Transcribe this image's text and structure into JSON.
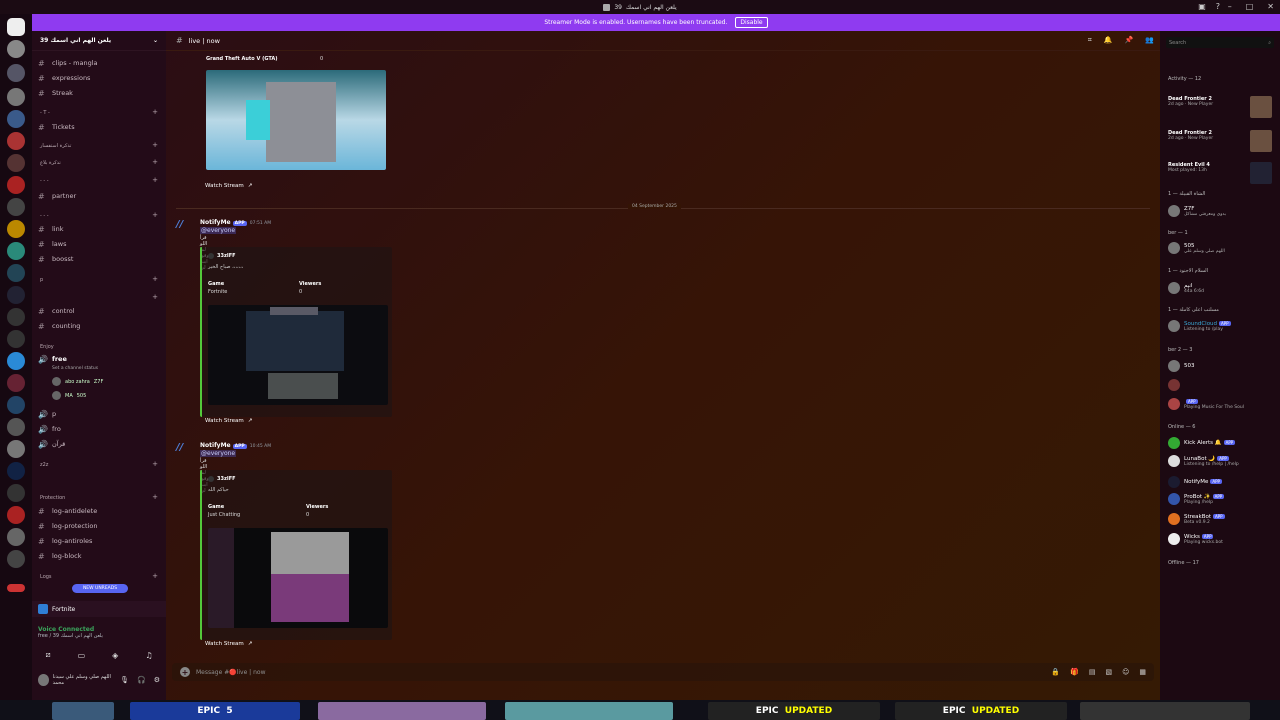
{
  "titlebar": {
    "title": "يلعن الهم اني اسمك",
    "count": "39"
  },
  "streamer": {
    "text": "Streamer Mode is enabled. Usernames have been truncated.",
    "disable_label": "Disable"
  },
  "server": {
    "name": "يلعن الهم اني اسمك",
    "count": "39"
  },
  "channels": [
    {
      "label": "clips - mangla",
      "type": "text"
    },
    {
      "label": "expressions",
      "type": "text"
    },
    {
      "label": "Streak",
      "type": "text"
    },
    {
      "label": "Tickets",
      "type": "text"
    },
    {
      "label": "partner",
      "type": "text"
    },
    {
      "label": "link",
      "type": "text"
    },
    {
      "label": "laws",
      "type": "text"
    },
    {
      "label": "boosst",
      "type": "text"
    },
    {
      "label": "control",
      "type": "text"
    },
    {
      "label": "counting",
      "type": "text"
    },
    {
      "label": "free",
      "type": "voice"
    },
    {
      "label": "p",
      "type": "voice"
    },
    {
      "label": "fro",
      "type": "voice"
    },
    {
      "label": "قرآن",
      "type": "voice"
    },
    {
      "label": "log-antidelete",
      "type": "text"
    },
    {
      "label": "log-protection",
      "type": "text"
    },
    {
      "label": "log-antiroles",
      "type": "text"
    },
    {
      "label": "log-block",
      "type": "text"
    }
  ],
  "categories": [
    "- T -",
    "تذكرة استفسار",
    "تذكرة بلاغ",
    "- - -",
    "- - -",
    "p",
    "Enjoy",
    "z2z",
    "Protection",
    "Logs"
  ],
  "voice": {
    "channel_status": "Set a channel status",
    "users": [
      {
        "name": "abo zahra",
        "tag": "Z7F"
      },
      {
        "name": "MA",
        "tag": "505"
      }
    ]
  },
  "new_unreads": "NEW UNREADS",
  "activity_game": "Fortnite",
  "voice_connected": {
    "title": "Voice Connected",
    "sub": "free / 39 يلعن الهم اني اسمك"
  },
  "user_panel": {
    "name": "اللهم صلي وسلم علي سيدنا محمد"
  },
  "chat": {
    "channel": "live | now",
    "first_embed": {
      "game_title": "Grand Theft Auto V (GTA)",
      "viewers": "0",
      "watch": "Watch Stream"
    },
    "date_divider": "04 September 2025",
    "messages": [
      {
        "author": "NotifyMe",
        "app": "APP",
        "time": "07:51 AM",
        "mention": "@everyone",
        "text": "قرأ اللو لما شوفوا ابت لي",
        "embed": {
          "author": "33zIFF",
          "desc": "صباح الخير ،،،،،،،",
          "game_label": "Game",
          "game": "Fortnite",
          "viewers_label": "Viewers",
          "viewers": "0"
        },
        "watch": "Watch Stream"
      },
      {
        "author": "NotifyMe",
        "app": "APP",
        "time": "10:45 AM",
        "mention": "@everyone",
        "text": "قرأ اللو لما شوفوا ابت لي",
        "embed": {
          "author": "33zIFF",
          "desc": "حياكم الله",
          "game_label": "Game",
          "game": "Just Chatting",
          "viewers_label": "Viewers",
          "viewers": "0"
        },
        "watch": "Watch Stream"
      }
    ],
    "composer_placeholder": "Message #🔴live | now"
  },
  "members": {
    "search": "Search",
    "activity_header": "Activity — 12",
    "activities": [
      {
        "title": "Dead Frontier 2",
        "sub": "2d ago · New Player"
      },
      {
        "title": "Dead Frontier 2",
        "sub": "2d ago · New Player"
      },
      {
        "title": "Resident Evil 4",
        "sub": "Most played: 13h"
      }
    ],
    "groups": [
      {
        "header": "الشاة القبيلة — 1",
        "members": [
          {
            "name": "Z7F",
            "sub": "بدوي ومعرفتي مشاكل"
          }
        ]
      },
      {
        "header": "ber — 1",
        "members": [
          {
            "name": "505",
            "sub": "اللهم صلي وسلم علي"
          }
        ]
      },
      {
        "header": "السلام الاجنود — 1",
        "members": [
          {
            "name": "انيم",
            "sub": "44a 6:6d"
          }
        ]
      },
      {
        "header": "مسلتب اعلى كاملة — 1",
        "members": [
          {
            "name": "SoundCloud",
            "sub": "Listening to /play",
            "app": "APP"
          }
        ]
      },
      {
        "header": "ber 2 — 3",
        "members": [
          {
            "name": "503",
            "sub": ""
          },
          {
            "name": "",
            "sub": ""
          },
          {
            "name": "",
            "sub": "Playing Music For The Soul",
            "app": "APP"
          }
        ]
      },
      {
        "header": "Online — 6",
        "members": [
          {
            "name": "Kick Alerts 🔔",
            "sub": "",
            "app": "APP"
          },
          {
            "name": "LunaBot 🌙",
            "sub": "Listening to /help | /help",
            "app": "APP"
          },
          {
            "name": "NotifyMe",
            "sub": "",
            "app": "APP"
          },
          {
            "name": "ProBot ✨",
            "sub": "Playing /help",
            "app": "APP"
          },
          {
            "name": "StreakBot",
            "sub": "Beta v0.9.2",
            "app": "APP"
          },
          {
            "name": "Wicks",
            "sub": "Playing wicks.bot",
            "app": "APP"
          }
        ]
      },
      {
        "header": "Offline — 17",
        "members": []
      }
    ]
  },
  "taskbar": [
    "EPIC",
    "5",
    "UPDATED",
    "UPDATED",
    "EPIC",
    "EPIC"
  ]
}
